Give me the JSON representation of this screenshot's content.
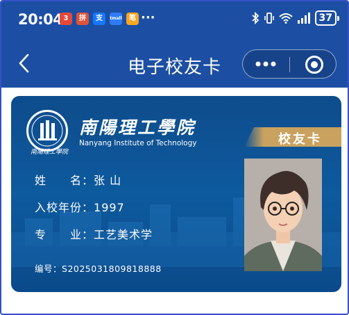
{
  "status_bar": {
    "time": "20:04",
    "apps": [
      "3",
      "拼",
      "支",
      "tmall",
      "笔"
    ],
    "more": "···",
    "battery": "37"
  },
  "nav": {
    "back_icon": "chevron-left-icon",
    "title": "电子校友卡",
    "more_icon": "more-dots-icon",
    "close_icon": "target-circle-icon"
  },
  "card": {
    "school_cn": "南陽理工學院",
    "school_en": "Nanyang Institute of Technology",
    "school_cn_small": "南陽理工學院",
    "banner": "校友卡",
    "fields": {
      "name_label": "姓　　名：",
      "name_value": "张 山",
      "year_label": "入校年份：",
      "year_value": "1997",
      "major_label": "专　　业：",
      "major_value": "工艺美术学"
    },
    "id_label": "编号：",
    "id_value": "S2025031809818888"
  },
  "colors": {
    "header_bg": "#1c4fa3",
    "card_bg": "#0d5a9e",
    "banner_gold": "#c9a25f"
  }
}
